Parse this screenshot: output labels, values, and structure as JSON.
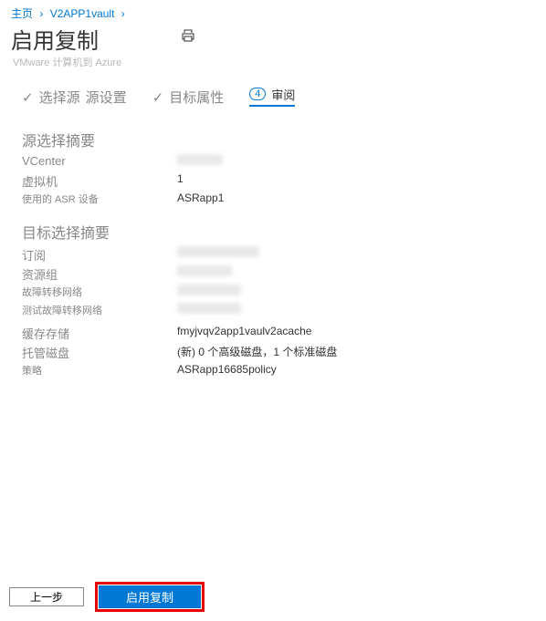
{
  "breadcrumb": {
    "home": "主页",
    "vault": "V2APP1vault"
  },
  "page": {
    "title": "启用复制",
    "subtitle": "VMware 计算机到 Azure",
    "print_icon": "print-icon"
  },
  "steps": {
    "s1": "选择源",
    "s2": "源设置",
    "s3": "目标属性",
    "s4_num": "4",
    "s4_label": "审阅"
  },
  "source": {
    "heading": "源选择摘要",
    "vcenter_label": "VCenter",
    "vm_label": "虚拟机",
    "vm_value": "1",
    "asr_label": "使用的 ASR 设备",
    "asr_value": "ASRapp1"
  },
  "target": {
    "heading": "目标选择摘要",
    "sub_label": "订阅",
    "rg_label": "资源组",
    "failnet_label": "故障转移网络",
    "testnet_label": "测试故障转移网络",
    "cache_label": "缓存存储",
    "cache_value": "fmyjvqv2app1vaulv2acache",
    "disk_label": "托管磁盘",
    "disk_value": "(新) 0 个高级磁盘，1 个标准磁盘",
    "policy_label": "策略",
    "policy_value": "ASRapp16685policy"
  },
  "footer": {
    "prev": "上一步",
    "enable": "启用复制"
  }
}
